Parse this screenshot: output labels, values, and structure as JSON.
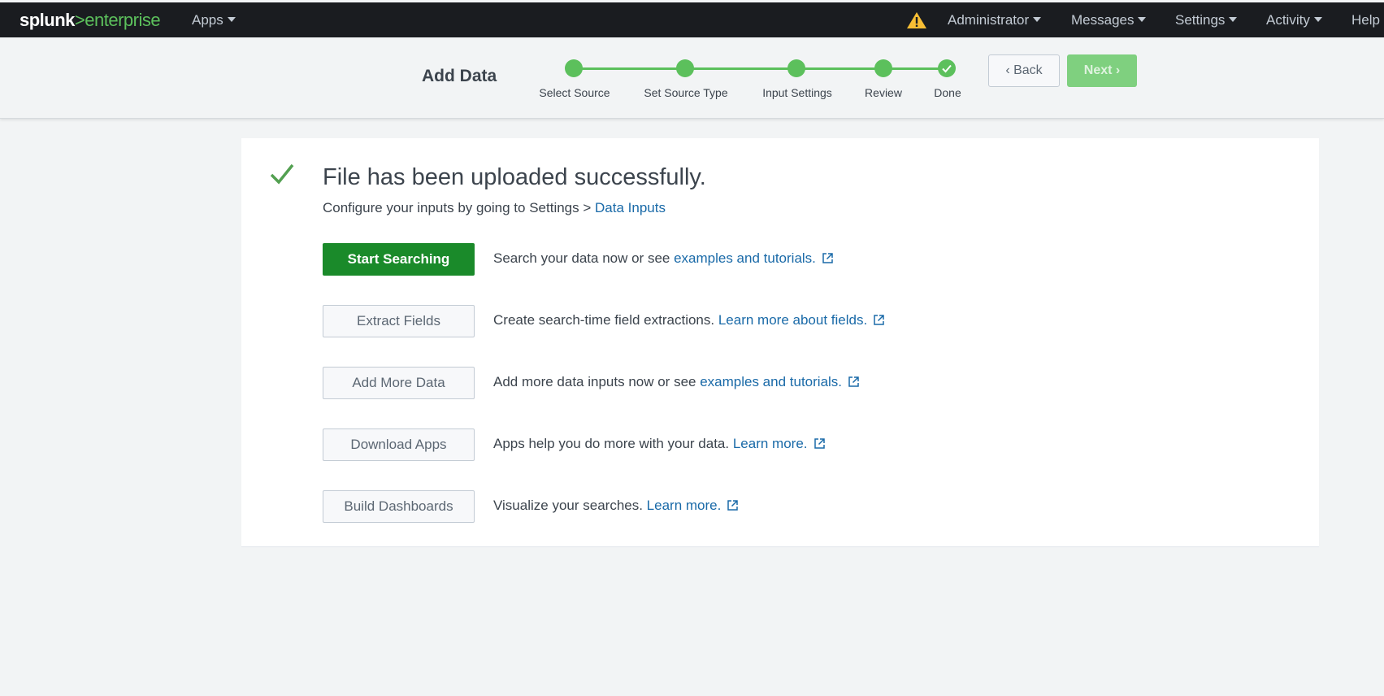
{
  "topbar": {
    "logo_left": "splunk",
    "logo_gt": ">",
    "logo_right": "enterprise",
    "apps": "Apps",
    "administrator": "Administrator",
    "messages": "Messages",
    "settings": "Settings",
    "activity": "Activity",
    "help": "Help"
  },
  "wizard": {
    "title": "Add Data",
    "steps": [
      "Select Source",
      "Set Source Type",
      "Input Settings",
      "Review",
      "Done"
    ],
    "back_label": "Back",
    "next_label": "Next"
  },
  "result": {
    "headline": "File has been uploaded successfully.",
    "sub_prefix": "Configure your inputs by going to Settings > ",
    "sub_link": "Data Inputs"
  },
  "actions": [
    {
      "button": "Start Searching",
      "desc": "Search your data now or see ",
      "link": "examples and tutorials."
    },
    {
      "button": "Extract Fields",
      "desc": "Create search-time field extractions. ",
      "link": "Learn more about fields."
    },
    {
      "button": "Add More Data",
      "desc": "Add more data inputs now or see ",
      "link": "examples and tutorials."
    },
    {
      "button": "Download Apps",
      "desc": "Apps help you do more with your data. ",
      "link": "Learn more."
    },
    {
      "button": "Build Dashboards",
      "desc": "Visualize your searches. ",
      "link": "Learn more."
    }
  ],
  "colors": {
    "accent_green": "#5cc05c",
    "primary_button": "#1a8a2a",
    "link": "#1a6aa8",
    "warning": "#f8be34"
  }
}
